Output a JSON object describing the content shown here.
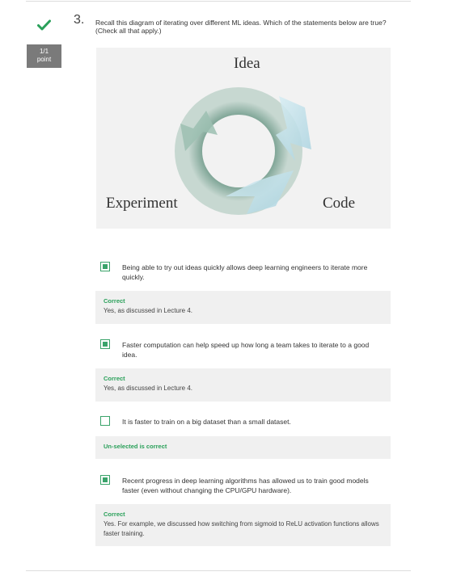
{
  "question": {
    "number": "3.",
    "score_line1": "1/1",
    "score_line2": "point",
    "prompt": "Recall this diagram of iterating over different ML ideas. Which of the statements below are true? (Check all that apply.)"
  },
  "diagram": {
    "label_idea": "Idea",
    "label_experiment": "Experiment",
    "label_code": "Code"
  },
  "options": [
    {
      "text": "Being able to try out ideas quickly allows deep learning engineers to iterate more quickly.",
      "checked": true,
      "feedback_status": "Correct",
      "feedback_message": "Yes, as discussed in Lecture 4."
    },
    {
      "text": "Faster computation can help speed up how long a team takes to iterate to a good idea.",
      "checked": true,
      "feedback_status": "Correct",
      "feedback_message": "Yes, as discussed in Lecture 4."
    },
    {
      "text": "It is faster to train on a big dataset than a small dataset.",
      "checked": false,
      "feedback_status": "Un-selected is correct",
      "feedback_message": ""
    },
    {
      "text": "Recent progress in deep learning algorithms has allowed us to train good models faster (even without changing the CPU/GPU hardware).",
      "checked": true,
      "feedback_status": "Correct",
      "feedback_message": "Yes. For example, we discussed how switching from sigmoid to ReLU activation functions allows faster training."
    }
  ],
  "colors": {
    "accent_green": "#2aa05a",
    "badge_gray": "#7a7a7a",
    "feedback_bg": "#f0f0f0"
  }
}
